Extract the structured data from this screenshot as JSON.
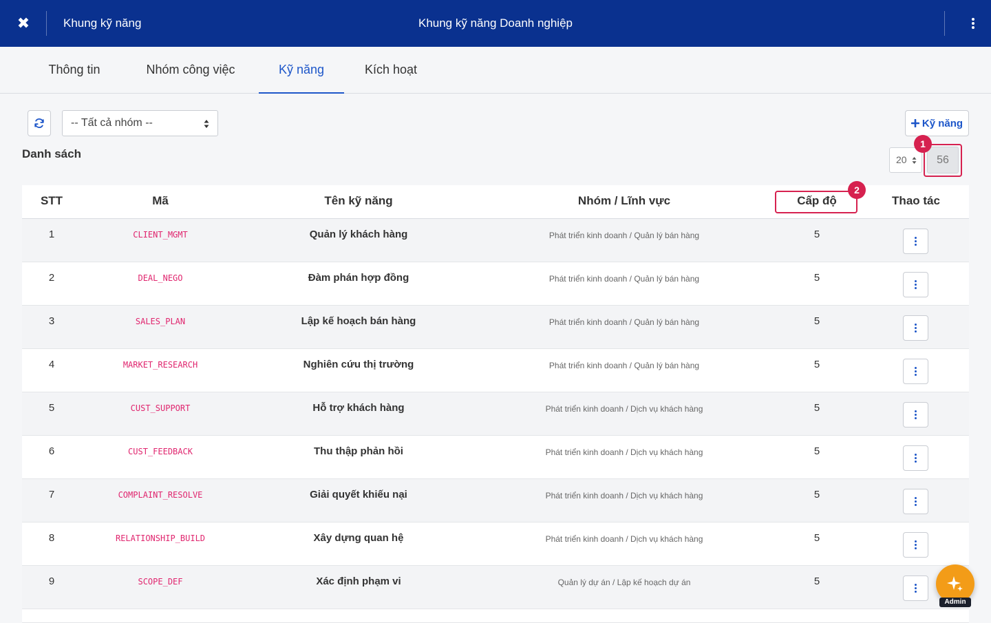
{
  "header": {
    "close_symbol": "✖",
    "app_title": "Khung kỹ năng",
    "page_title": "Khung kỹ năng Doanh nghiệp"
  },
  "tabs": [
    {
      "label": "Thông tin",
      "active": false
    },
    {
      "label": "Nhóm công việc",
      "active": false
    },
    {
      "label": "Kỹ năng",
      "active": true
    },
    {
      "label": "Kích hoạt",
      "active": false
    }
  ],
  "toolbar": {
    "group_filter_value": "-- Tất cả nhóm --",
    "add_skill_label": "Kỹ năng"
  },
  "list": {
    "title": "Danh sách",
    "page_size": "20",
    "total": "56"
  },
  "markers": {
    "m1": "1",
    "m2": "2"
  },
  "table": {
    "columns": [
      "STT",
      "Mã",
      "Tên kỹ năng",
      "Nhóm / Lĩnh vực",
      "Cấp độ",
      "Thao tác"
    ],
    "rows": [
      {
        "stt": "1",
        "code": "CLIENT_MGMT",
        "name": "Quản lý khách hàng",
        "group": "Phát triển kinh doanh / Quản lý bán hàng",
        "level": "5"
      },
      {
        "stt": "2",
        "code": "DEAL_NEGO",
        "name": "Đàm phán hợp đồng",
        "group": "Phát triển kinh doanh / Quản lý bán hàng",
        "level": "5"
      },
      {
        "stt": "3",
        "code": "SALES_PLAN",
        "name": "Lập kế hoạch bán hàng",
        "group": "Phát triển kinh doanh / Quản lý bán hàng",
        "level": "5"
      },
      {
        "stt": "4",
        "code": "MARKET_RESEARCH",
        "name": "Nghiên cứu thị trường",
        "group": "Phát triển kinh doanh / Quản lý bán hàng",
        "level": "5"
      },
      {
        "stt": "5",
        "code": "CUST_SUPPORT",
        "name": "Hỗ trợ khách hàng",
        "group": "Phát triển kinh doanh / Dịch vụ khách hàng",
        "level": "5"
      },
      {
        "stt": "6",
        "code": "CUST_FEEDBACK",
        "name": "Thu thập phản hồi",
        "group": "Phát triển kinh doanh / Dịch vụ khách hàng",
        "level": "5"
      },
      {
        "stt": "7",
        "code": "COMPLAINT_RESOLVE",
        "name": "Giải quyết khiếu nại",
        "group": "Phát triển kinh doanh / Dịch vụ khách hàng",
        "level": "5"
      },
      {
        "stt": "8",
        "code": "RELATIONSHIP_BUILD",
        "name": "Xây dựng quan hệ",
        "group": "Phát triển kinh doanh / Dịch vụ khách hàng",
        "level": "5"
      },
      {
        "stt": "9",
        "code": "SCOPE_DEF",
        "name": "Xác định phạm vi",
        "group": "Quản lý dự án / Lập kế hoạch dự án",
        "level": "5"
      }
    ]
  },
  "fab": {
    "badge": "Admin"
  },
  "colors": {
    "header_bg": "#0a318f",
    "accent": "#1d56c9",
    "code_text": "#e0256e",
    "highlight": "#d6214f",
    "fab": "#f39c18"
  },
  "icons": {
    "close": "close-icon",
    "more": "kebab-icon",
    "refresh": "refresh-icon",
    "add": "plus-icon",
    "row_action": "kebab-icon",
    "fab": "sparkle-icon"
  }
}
